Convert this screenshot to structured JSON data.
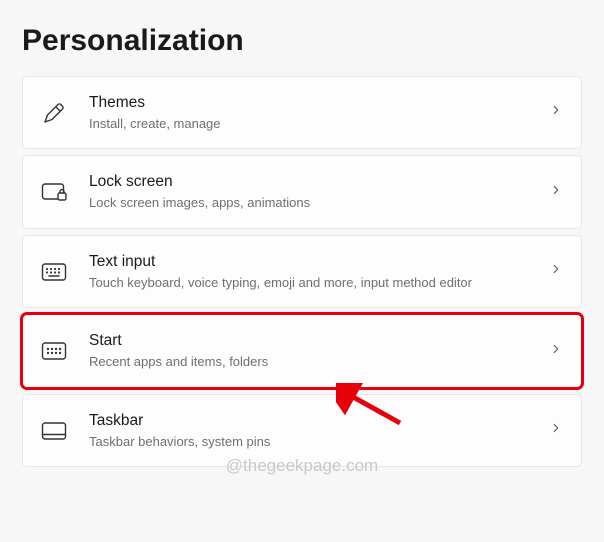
{
  "page_title": "Personalization",
  "items": [
    {
      "icon": "pen-icon",
      "title": "Themes",
      "desc": "Install, create, manage",
      "highlight": false
    },
    {
      "icon": "lockscreen-icon",
      "title": "Lock screen",
      "desc": "Lock screen images, apps, animations",
      "highlight": false
    },
    {
      "icon": "keyboard-icon",
      "title": "Text input",
      "desc": "Touch keyboard, voice typing, emoji and more, input method editor",
      "highlight": false
    },
    {
      "icon": "start-icon",
      "title": "Start",
      "desc": "Recent apps and items, folders",
      "highlight": true
    },
    {
      "icon": "taskbar-icon",
      "title": "Taskbar",
      "desc": "Taskbar behaviors, system pins",
      "highlight": false
    }
  ],
  "watermark": "@thegeekpage.com"
}
